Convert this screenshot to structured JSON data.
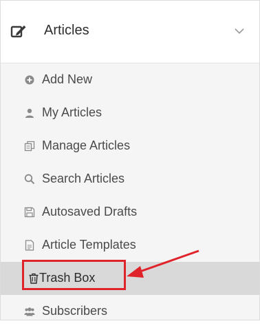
{
  "menu": {
    "header": {
      "title": "Articles",
      "icon": "edit-icon",
      "chevron": "chevron-down-icon"
    },
    "items": [
      {
        "label": "Add New",
        "icon": "plus-circle-icon"
      },
      {
        "label": "My Articles",
        "icon": "user-icon"
      },
      {
        "label": "Manage Articles",
        "icon": "copy-icon"
      },
      {
        "label": "Search Articles",
        "icon": "search-icon"
      },
      {
        "label": "Autosaved Drafts",
        "icon": "floppy-disk-icon"
      },
      {
        "label": "Article Templates",
        "icon": "document-icon"
      },
      {
        "label": "Trash Box",
        "icon": "trash-icon",
        "active": true
      },
      {
        "label": "Subscribers",
        "icon": "users-icon"
      }
    ]
  },
  "colors": {
    "highlight": "#e0232a",
    "active_bg": "#d9d9d9",
    "submenu_bg": "#f5f5f5"
  }
}
